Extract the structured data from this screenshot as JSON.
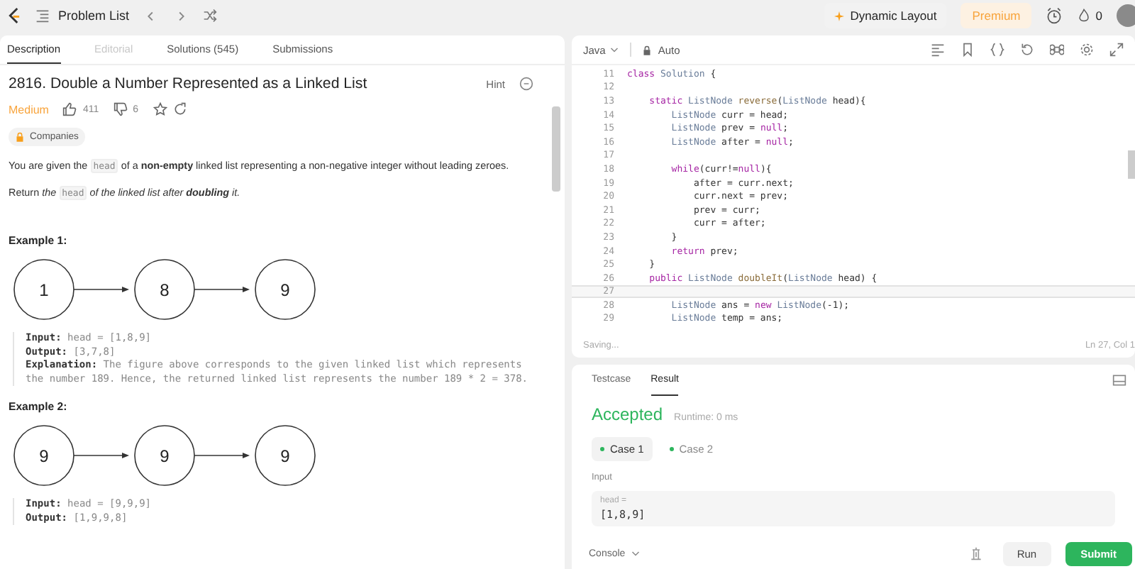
{
  "top_bar": {
    "title": "Problem List",
    "layout_button": "Dynamic Layout",
    "premium": "Premium",
    "streak": "0"
  },
  "tabs": [
    {
      "label": "Description",
      "selected": true,
      "disabled": false
    },
    {
      "label": "Editorial",
      "selected": false,
      "disabled": true
    },
    {
      "label": "Solutions (545)",
      "selected": false,
      "disabled": false
    },
    {
      "label": "Submissions",
      "selected": false,
      "disabled": false
    }
  ],
  "problem": {
    "title": "2816. Double a Number Represented as a Linked List",
    "hint": "Hint",
    "difficulty": "Medium",
    "likes": "411",
    "dislikes": "6",
    "tag": "Companies",
    "paragraphs": [
      [
        {
          "kind": "text",
          "text": "You are given the "
        },
        {
          "kind": "code",
          "text": "head"
        },
        {
          "kind": "text",
          "text": " of a **non-empty** linked list representing a non-negative integer without leading zeroes."
        }
      ],
      [
        {
          "kind": "text",
          "text": "Return "
        },
        {
          "kind": "em",
          "text": "the "
        },
        {
          "kind": "code",
          "text": "head"
        },
        {
          "kind": "em",
          "text": " of the linked list after **doubling** it."
        }
      ]
    ],
    "examples": [
      {
        "heading": "Example 1:",
        "nodes": [
          "1",
          "8",
          "9"
        ],
        "lines": [
          "**Input:** head = [1,8,9]",
          "**Output:** [3,7,8]",
          "**Explanation:** The figure above corresponds to the given linked list which represents the number 189. Hence, the returned linked list represents the number 189 * 2 = 378."
        ]
      },
      {
        "heading": "Example 2:",
        "nodes": [
          "9",
          "9",
          "9"
        ],
        "lines": [
          "**Input:** head = [9,9,9]",
          "**Output:** [1,9,9,8]"
        ]
      }
    ]
  },
  "editor": {
    "language": "Java",
    "mode": "Auto",
    "status": "Saving...",
    "cursor": "Ln 27, Col 1",
    "lines": [
      {
        "number": "11",
        "active": false,
        "tokens": [
          {
            "kind": "kw",
            "text": "class"
          },
          {
            "kind": "type",
            "text": " Solution"
          },
          {
            "kind": "plain",
            "text": " {"
          }
        ]
      },
      {
        "number": "12",
        "active": false
      },
      {
        "number": "13",
        "active": false,
        "tokens": [
          {
            "kind": "kw",
            "text": "    static"
          },
          {
            "kind": "type",
            "text": " ListNode"
          },
          {
            "kind": "fn",
            "text": " reverse"
          },
          {
            "kind": "plain",
            "text": "("
          },
          {
            "kind": "type",
            "text": "ListNode"
          },
          {
            "kind": "plain",
            "text": " head){"
          }
        ]
      },
      {
        "number": "14",
        "active": false,
        "tokens": [
          {
            "kind": "type",
            "text": "        ListNode"
          },
          {
            "kind": "plain",
            "text": " curr = head;"
          }
        ]
      },
      {
        "number": "15",
        "active": false,
        "tokens": [
          {
            "kind": "type",
            "text": "        ListNode"
          },
          {
            "kind": "plain",
            "text": " prev = "
          },
          {
            "kind": "kw",
            "text": "null"
          },
          {
            "kind": "plain",
            "text": ";"
          }
        ]
      },
      {
        "number": "16",
        "active": false,
        "tokens": [
          {
            "kind": "type",
            "text": "        ListNode"
          },
          {
            "kind": "plain",
            "text": " after = "
          },
          {
            "kind": "kw",
            "text": "null"
          },
          {
            "kind": "plain",
            "text": ";"
          }
        ]
      },
      {
        "number": "17",
        "active": false
      },
      {
        "number": "18",
        "active": false,
        "tokens": [
          {
            "kind": "kw",
            "text": "        while"
          },
          {
            "kind": "plain",
            "text": "(curr!="
          },
          {
            "kind": "kw",
            "text": "null"
          },
          {
            "kind": "plain",
            "text": "){"
          }
        ]
      },
      {
        "number": "19",
        "active": false,
        "tokens": [
          {
            "kind": "plain",
            "text": "            after = curr.next;"
          }
        ]
      },
      {
        "number": "20",
        "active": false,
        "tokens": [
          {
            "kind": "plain",
            "text": "            curr.next = prev;"
          }
        ]
      },
      {
        "number": "21",
        "active": false,
        "tokens": [
          {
            "kind": "plain",
            "text": "            prev = curr;"
          }
        ]
      },
      {
        "number": "22",
        "active": false,
        "tokens": [
          {
            "kind": "plain",
            "text": "            curr = after;"
          }
        ]
      },
      {
        "number": "23",
        "active": false,
        "tokens": [
          {
            "kind": "plain",
            "text": "        }"
          }
        ]
      },
      {
        "number": "24",
        "active": false,
        "tokens": [
          {
            "kind": "kw",
            "text": "        return"
          },
          {
            "kind": "plain",
            "text": " prev;"
          }
        ]
      },
      {
        "number": "25",
        "active": false,
        "tokens": [
          {
            "kind": "plain",
            "text": "    }"
          }
        ]
      },
      {
        "number": "26",
        "active": false,
        "tokens": [
          {
            "kind": "kw",
            "text": "    public"
          },
          {
            "kind": "type",
            "text": " ListNode"
          },
          {
            "kind": "fn",
            "text": " doubleIt"
          },
          {
            "kind": "plain",
            "text": "("
          },
          {
            "kind": "type",
            "text": "ListNode"
          },
          {
            "kind": "plain",
            "text": " head) {"
          }
        ]
      },
      {
        "number": "27",
        "active": true
      },
      {
        "number": "28",
        "active": false,
        "tokens": [
          {
            "kind": "type",
            "text": "        ListNode"
          },
          {
            "kind": "plain",
            "text": " ans = "
          },
          {
            "kind": "kw",
            "text": "new"
          },
          {
            "kind": "type",
            "text": " ListNode"
          },
          {
            "kind": "plain",
            "text": "(-1);"
          }
        ]
      },
      {
        "number": "29",
        "active": false,
        "tokens": [
          {
            "kind": "type",
            "text": "        ListNode"
          },
          {
            "kind": "plain",
            "text": " temp = ans;"
          }
        ]
      }
    ]
  },
  "console": {
    "tabs": [
      {
        "label": "Testcase",
        "selected": false
      },
      {
        "label": "Result",
        "selected": true
      }
    ],
    "verdict": "Accepted",
    "runtime": "Runtime: 0 ms",
    "cases": [
      {
        "label": "Case 1",
        "selected": true
      },
      {
        "label": "Case 2",
        "selected": false
      }
    ],
    "input_label": "Input",
    "param": "head =",
    "value": "[1,8,9]",
    "console_toggle": "Console",
    "run": "Run",
    "submit": "Submit"
  }
}
